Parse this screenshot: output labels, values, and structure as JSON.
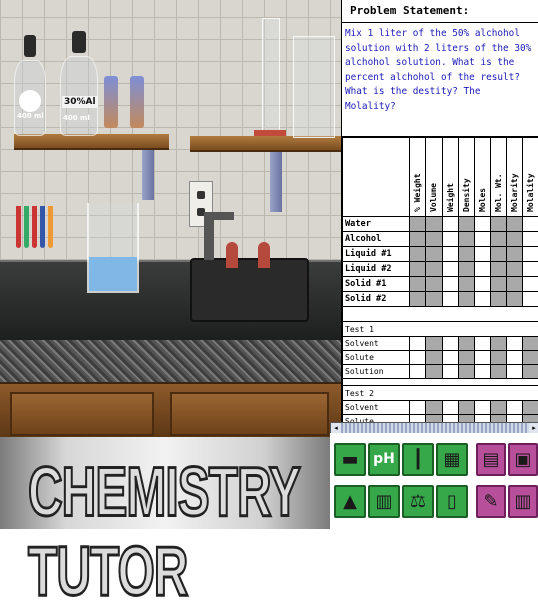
{
  "scene": {
    "bottle_labels": [
      "400 ml",
      "30%Al",
      "400 ml"
    ]
  },
  "problem": {
    "title": "Problem Statement:",
    "text": "Mix 1 liter of the 50% alchohol solution with 2 liters of the 30% alchohol solution. What is the percent alchohol of the result? What is the destity? The Molality?"
  },
  "grid": {
    "columns": [
      "% Weight",
      "Volume",
      "Weight",
      "Density",
      "Moles",
      "Mol. Wt.",
      "Molarity",
      "Molality"
    ],
    "rows": [
      "Water",
      "Alcohol",
      "Liquid #1",
      "Liquid #2",
      "Solid #1",
      "Solid #2"
    ],
    "sections": [
      {
        "title": "Test 1",
        "subs": [
          "Solvent",
          "Solute",
          "Solution"
        ]
      },
      {
        "title": "Test 2",
        "subs": [
          "Solvent",
          "Solute"
        ]
      }
    ]
  },
  "banner": {
    "title": "CHEMISTRY TUTOR"
  },
  "tools": [
    {
      "name": "thermometer-tool",
      "glyph": "▬"
    },
    {
      "name": "ph-meter-tool",
      "glyph": "pH"
    },
    {
      "name": "test-tube-tool",
      "glyph": "┃"
    },
    {
      "name": "periodic-table-tool",
      "glyph": "▦"
    },
    {
      "name": "calculator-tool",
      "glyph": "▤"
    },
    {
      "name": "data-tool",
      "glyph": "▣"
    },
    {
      "name": "burner-tool",
      "glyph": "▲"
    },
    {
      "name": "library-tool",
      "glyph": "▥"
    },
    {
      "name": "balance-tool",
      "glyph": "⚖"
    },
    {
      "name": "container-tool",
      "glyph": "▯"
    },
    {
      "name": "notepad-tool",
      "glyph": "✎"
    },
    {
      "name": "books-tool",
      "glyph": "▥"
    }
  ],
  "colors": {
    "problem_text": "#1b1bb8",
    "tool_green": "#36a84a",
    "tool_pink": "#b74f9a",
    "grid_gray": "#a9a9a9"
  }
}
